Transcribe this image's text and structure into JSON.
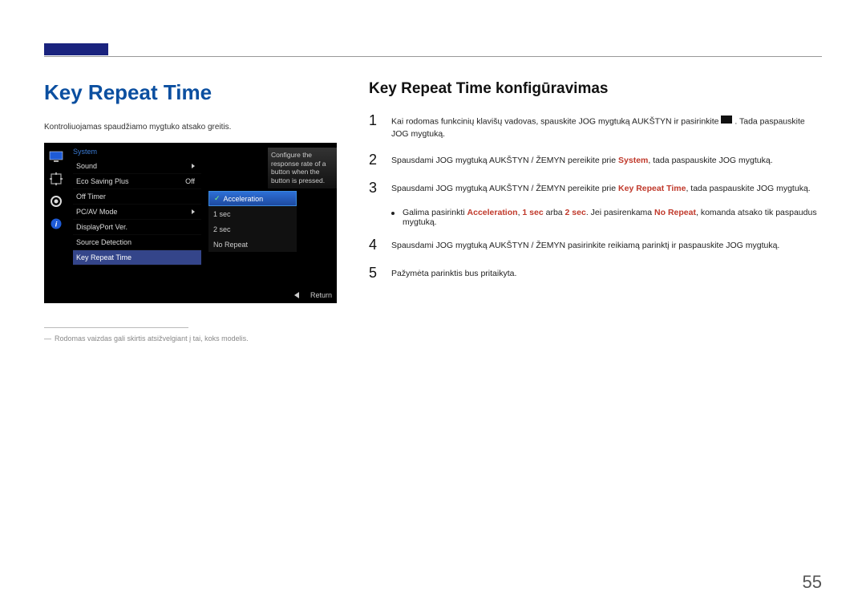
{
  "page_number": "55",
  "left": {
    "title": "Key Repeat Time",
    "desc": "Kontroliuojamas spaudžiamo mygtuko atsako greitis.",
    "footnote": "Rodomas vaizdas gali skirtis atsižvelgiant į tai, koks modelis."
  },
  "osd": {
    "section": "System",
    "items": [
      {
        "label": "Sound",
        "value": "",
        "arrow": true
      },
      {
        "label": "Eco Saving Plus",
        "value": "Off"
      },
      {
        "label": "Off Timer",
        "value": ""
      },
      {
        "label": "PC/AV Mode",
        "value": "",
        "arrow": true
      },
      {
        "label": "DisplayPort Ver.",
        "value": ""
      },
      {
        "label": "Source Detection",
        "value": ""
      },
      {
        "label": "Key Repeat Time",
        "value": "",
        "selected": true
      }
    ],
    "submenu": [
      "Acceleration",
      "1 sec",
      "2 sec",
      "No Repeat"
    ],
    "submenu_active": 0,
    "tooltip": "Configure the response rate of a button when the button is pressed.",
    "return": "Return"
  },
  "right": {
    "title": "Key Repeat Time konfigūravimas",
    "steps": {
      "1a": "Kai rodomas funkcinių klavišų vadovas, spauskite JOG mygtuką AUKŠTYN ir pasirinkite ",
      "1b": ". Tada paspauskite JOG mygtuką.",
      "2a": "Spausdami JOG mygtuką AUKŠTYN / ŽEMYN pereikite prie ",
      "2_sys": "System",
      "2b": ", tada paspauskite JOG mygtuką.",
      "3a": "Spausdami JOG mygtuką AUKŠTYN / ŽEMYN pereikite prie ",
      "3_krt": "Key Repeat Time",
      "3b": ", tada paspauskite JOG mygtuką.",
      "bullet_a": "Galima pasirinkti ",
      "bullet_accel": "Acceleration",
      "bullet_sep1": ", ",
      "bullet_1sec": "1 sec",
      "bullet_or": " arba ",
      "bullet_2sec": "2 sec",
      "bullet_b": ". Jei pasirenkama ",
      "bullet_norep": "No Repeat",
      "bullet_c": ", komanda atsako tik paspaudus mygtuką.",
      "4": "Spausdami JOG mygtuką AUKŠTYN / ŽEMYN pasirinkite reikiamą parinktį ir paspauskite JOG mygtuką.",
      "5": "Pažymėta parinktis bus pritaikyta."
    }
  }
}
